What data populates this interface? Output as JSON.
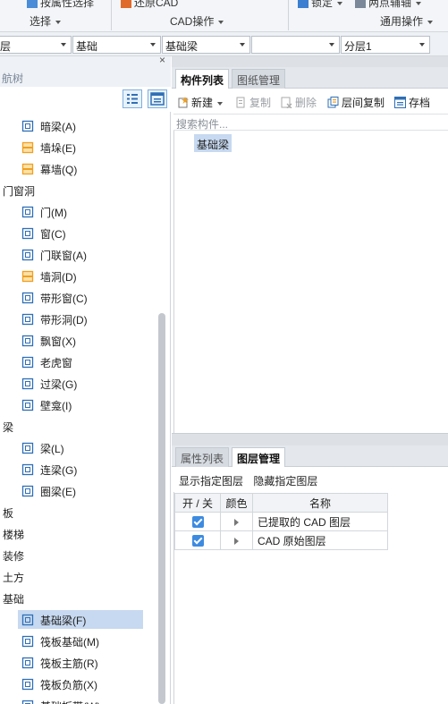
{
  "ribbon": {
    "cut_items": {
      "batch_select": "按属性选择",
      "restore_cad": "还原CAD",
      "lock": "锁定",
      "two_point_edit": "两点辅轴"
    },
    "groups": {
      "select": "选择",
      "cad_ops": "CAD操作",
      "common_ops": "通用操作"
    }
  },
  "combos": {
    "floor": "层",
    "category": "基础",
    "component_type": "基础梁",
    "component_name": "",
    "layer": "分层1"
  },
  "nav": {
    "close": "×",
    "title": "航树",
    "items": [
      {
        "kind": "item",
        "label": "暗梁(A)",
        "icon": "hidden-beam-icon"
      },
      {
        "kind": "item",
        "label": "墙垛(E)",
        "icon": "wall-pier-icon"
      },
      {
        "kind": "item",
        "label": "幕墙(Q)",
        "icon": "curtain-wall-icon"
      },
      {
        "kind": "category",
        "label": "门窗洞"
      },
      {
        "kind": "item",
        "label": "门(M)",
        "icon": "door-icon"
      },
      {
        "kind": "item",
        "label": "窗(C)",
        "icon": "window-icon"
      },
      {
        "kind": "item",
        "label": "门联窗(A)",
        "icon": "door-window-icon"
      },
      {
        "kind": "item",
        "label": "墙洞(D)",
        "icon": "wall-opening-icon"
      },
      {
        "kind": "item",
        "label": "带形窗(C)",
        "icon": "strip-window-icon"
      },
      {
        "kind": "item",
        "label": "带形洞(D)",
        "icon": "strip-opening-icon"
      },
      {
        "kind": "item",
        "label": "飘窗(X)",
        "icon": "bay-window-icon"
      },
      {
        "kind": "item",
        "label": "老虎窗",
        "icon": "dormer-window-icon"
      },
      {
        "kind": "item",
        "label": "过梁(G)",
        "icon": "lintel-icon"
      },
      {
        "kind": "item",
        "label": "壁龛(I)",
        "icon": "niche-icon"
      },
      {
        "kind": "category",
        "label": "梁"
      },
      {
        "kind": "item",
        "label": "梁(L)",
        "icon": "beam-icon"
      },
      {
        "kind": "item",
        "label": "连梁(G)",
        "icon": "coupling-beam-icon"
      },
      {
        "kind": "item",
        "label": "圈梁(E)",
        "icon": "ring-beam-icon"
      },
      {
        "kind": "category",
        "label": "板"
      },
      {
        "kind": "category",
        "label": "楼梯"
      },
      {
        "kind": "category",
        "label": "装修"
      },
      {
        "kind": "category",
        "label": "土方"
      },
      {
        "kind": "category",
        "label": "基础"
      },
      {
        "kind": "item",
        "label": "基础梁(F)",
        "icon": "foundation-beam-icon",
        "selected": true
      },
      {
        "kind": "item",
        "label": "筏板基础(M)",
        "icon": "raft-foundation-icon"
      },
      {
        "kind": "item",
        "label": "筏板主筋(R)",
        "icon": "raft-main-rebar-icon"
      },
      {
        "kind": "item",
        "label": "筏板负筋(X)",
        "icon": "raft-negative-rebar-icon"
      },
      {
        "kind": "item",
        "label": "基础板带(W)",
        "icon": "foundation-strip-icon"
      }
    ]
  },
  "component_panel": {
    "tabs": [
      "构件列表",
      "图纸管理"
    ],
    "toolbar": {
      "new": "新建",
      "copy": "复制",
      "delete": "删除",
      "floor_copy": "层间复制",
      "save": "存档"
    },
    "search_placeholder": "搜索构件...",
    "items": [
      "基础梁"
    ]
  },
  "layer_panel": {
    "tabs": [
      "属性列表",
      "图层管理"
    ],
    "actions": {
      "show": "显示指定图层",
      "hide": "隐藏指定图层"
    },
    "columns": {
      "onoff": "开 / 关",
      "color": "颜色",
      "name": "名称"
    },
    "rows": [
      {
        "checked": true,
        "name": "已提取的 CAD 图层"
      },
      {
        "checked": true,
        "name": "CAD 原始图层"
      }
    ]
  },
  "colors": {
    "accent": "#3d8be0",
    "selection": "#c7d9f0",
    "icon_blue": "#2f6fb5",
    "icon_orange": "#f0a020"
  }
}
